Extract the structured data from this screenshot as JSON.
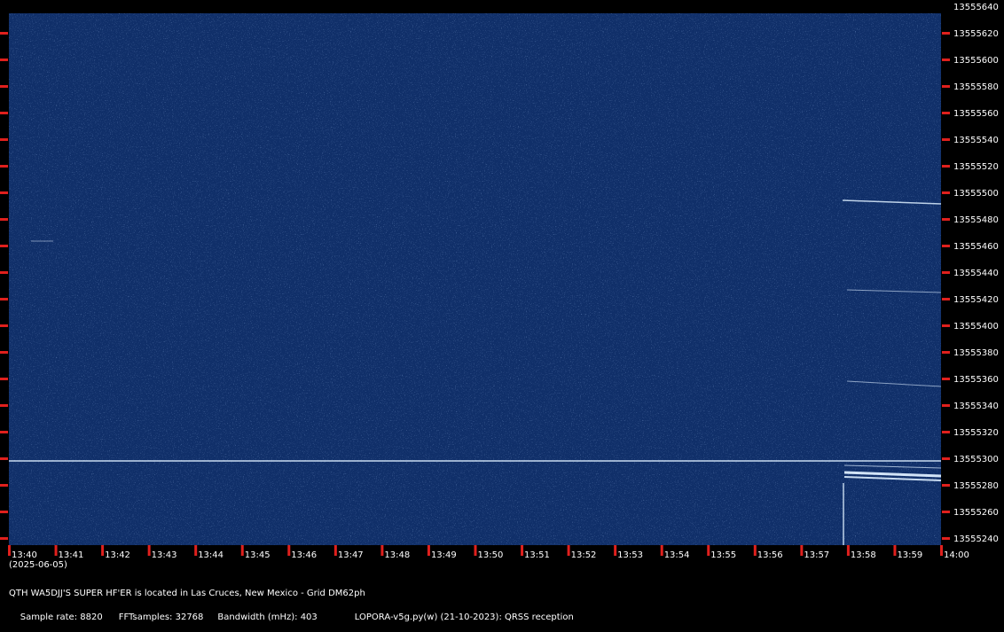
{
  "app": {
    "program": "LOPORA-v5g.py(w) (21-10-2023): QRSS reception"
  },
  "station": {
    "description": "QTH WA5DJJ'S SUPER HF'ER is located in Las Cruces, New Mexico - Grid DM62ph"
  },
  "footer": {
    "sample_rate": "Sample rate: 8820",
    "fft_samples": "FFTsamples: 32768",
    "bandwidth": "Bandwidth (mHz): 403",
    "program": "LOPORA-v5g.py(w) (21-10-2023): QRSS reception"
  },
  "date": "(2025-06-05)",
  "colors": {
    "background": "#000000",
    "waterfall": "#102f69",
    "tick": "#e0201d",
    "signal": "#ddeeff"
  },
  "time_axis": [
    "13:40",
    "13:41",
    "13:42",
    "13:43",
    "13:44",
    "13:45",
    "13:46",
    "13:47",
    "13:48",
    "13:49",
    "13:50",
    "13:51",
    "13:52",
    "13:53",
    "13:54",
    "13:55",
    "13:56",
    "13:57",
    "13:58",
    "13:59",
    "14:00"
  ],
  "freq_axis": [
    "13555640",
    "13555620",
    "13555600",
    "13555580",
    "13555560",
    "13555540",
    "13555520",
    "13555500",
    "13555480",
    "13555460",
    "13555440",
    "13555420",
    "13555400",
    "13555380",
    "13555360",
    "13555340",
    "13555320",
    "13555300",
    "13555280",
    "13555260",
    "13555240"
  ]
}
